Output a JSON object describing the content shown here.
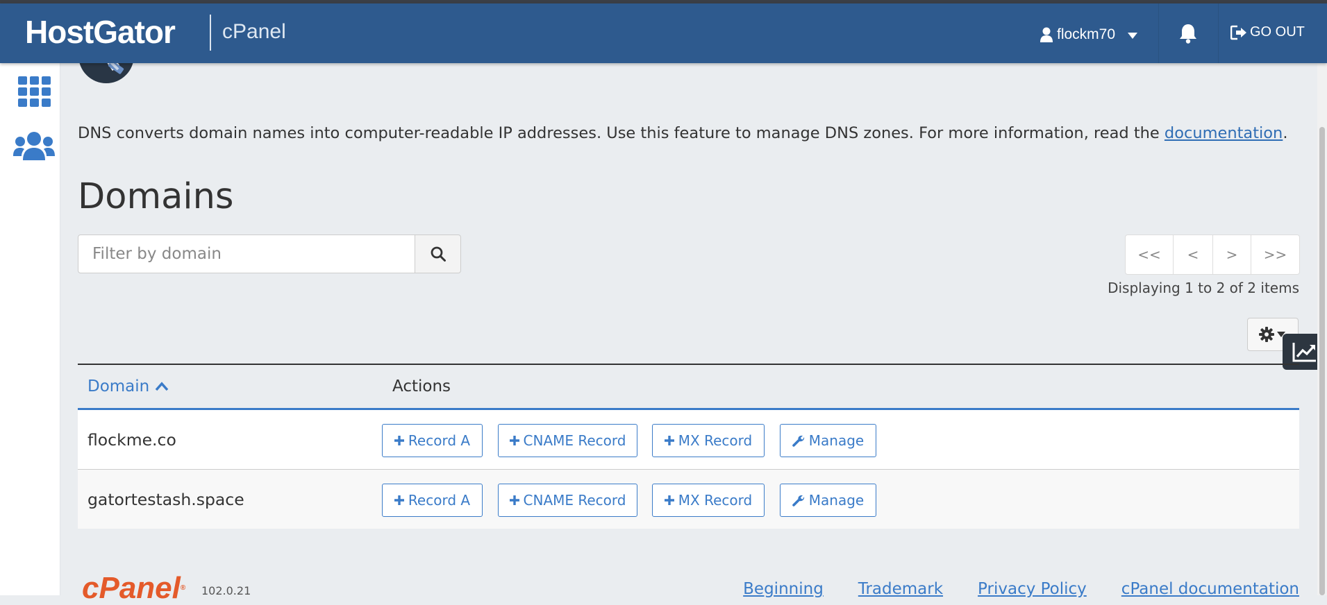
{
  "header": {
    "brand": "HostGator",
    "product": "cPanel",
    "username": "flockm70",
    "signout_label": "GO OUT",
    "user_icon": "user-icon",
    "notifications_icon": "bell-icon",
    "signout_icon": "sign-out-icon"
  },
  "sidebar": {
    "items": [
      {
        "icon": "grid-icon",
        "label": ""
      },
      {
        "icon": "users-icon",
        "label": ""
      }
    ]
  },
  "intro": {
    "text": "DNS converts domain names into computer-readable IP addresses. Use this feature to manage DNS zones. For more information, read the ",
    "link": "documentation",
    "tail": "."
  },
  "section_title": "Domains",
  "filter": {
    "placeholder": "Filter by domain"
  },
  "pager": {
    "first": "<<",
    "prev": "<",
    "next": ">",
    "last": ">>",
    "status": "Displaying 1 to 2 of 2 items"
  },
  "table": {
    "columns": [
      "Domain",
      "Actions"
    ],
    "sort": "ascending",
    "rows": [
      {
        "domain": "flockme.co",
        "actions": [
          "Record A",
          "CNAME Record",
          "MX Record",
          "Manage"
        ]
      },
      {
        "domain": "gatortestash.space",
        "actions": [
          "Record A",
          "CNAME Record",
          "MX Record",
          "Manage"
        ]
      }
    ]
  },
  "footer": {
    "logo": "cPanel",
    "version": "102.0.21",
    "links": [
      "Beginning",
      "Trademark",
      "Privacy Policy",
      "cPanel documentation"
    ]
  },
  "colors": {
    "header_bg": "#2e5a8e",
    "accent": "#3a7bc8",
    "page_bg": "#eaedf0",
    "cpanel_orange": "#e45a2a"
  }
}
